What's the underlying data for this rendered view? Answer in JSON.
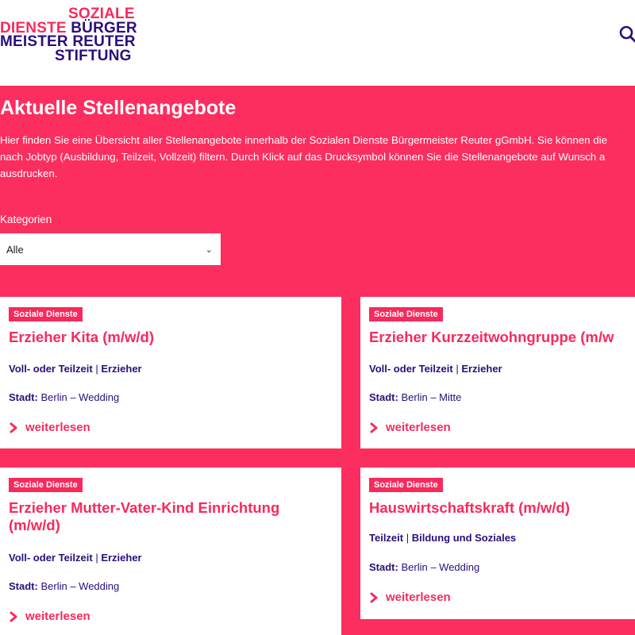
{
  "header": {
    "logo": {
      "line1": "SOZIALE",
      "line2_a": "DIENSTE",
      "line2_b": "BÜRGER",
      "line3": "MEISTER REUTER",
      "line4": "STIFTUNG"
    },
    "search_icon": "search-icon"
  },
  "hero": {
    "title": "Aktuelle Stellenangebote",
    "intro_line1": "Hier finden Sie eine Übersicht aller Stellenangebote innerhalb der Sozialen Dienste Bürgermeister Reuter gGmbH. Sie können die",
    "intro_line2": "nach Jobtyp (Ausbildung, Teilzeit, Vollzeit) filtern. Durch Klick auf das Drucksymbol können Sie die Stellenangebote auf Wunsch a",
    "intro_line3": "ausdrucken.",
    "filter_label": "Kategorien",
    "filter_value": "Alle"
  },
  "jobs": [
    {
      "badge": "Soziale Dienste",
      "title": "Erzieher Kita (m/w/d)",
      "type": "Voll- oder Teilzeit",
      "field": "Erzieher",
      "city_label": "Stadt:",
      "city": "Berlin – Wedding",
      "more": "weiterlesen"
    },
    {
      "badge": "Soziale Dienste",
      "title": "Erzieher Kurzzeitwohngruppe (m/w",
      "type": "Voll- oder Teilzeit",
      "field": "Erzieher",
      "city_label": "Stadt:",
      "city": "Berlin – Mitte",
      "more": "weiterlesen"
    },
    {
      "badge": "Soziale Dienste",
      "title": "Erzieher Mutter-Vater-Kind Einrichtung (m/w/d)",
      "type": "Voll- oder Teilzeit",
      "field": "Erzieher",
      "city_label": "Stadt:",
      "city": "Berlin – Wedding",
      "more": "weiterlesen"
    },
    {
      "badge": "Soziale Dienste",
      "title": "Hauswirtschaftskraft (m/w/d)",
      "type": "Teilzeit",
      "field": "Bildung und Soziales",
      "city_label": "Stadt:",
      "city": "Berlin – Wedding",
      "more": "weiterlesen"
    }
  ],
  "colors": {
    "brand_pink": "#f72a5d",
    "hero_bg": "#fb2e5f",
    "brand_navy": "#2a0f7a"
  }
}
